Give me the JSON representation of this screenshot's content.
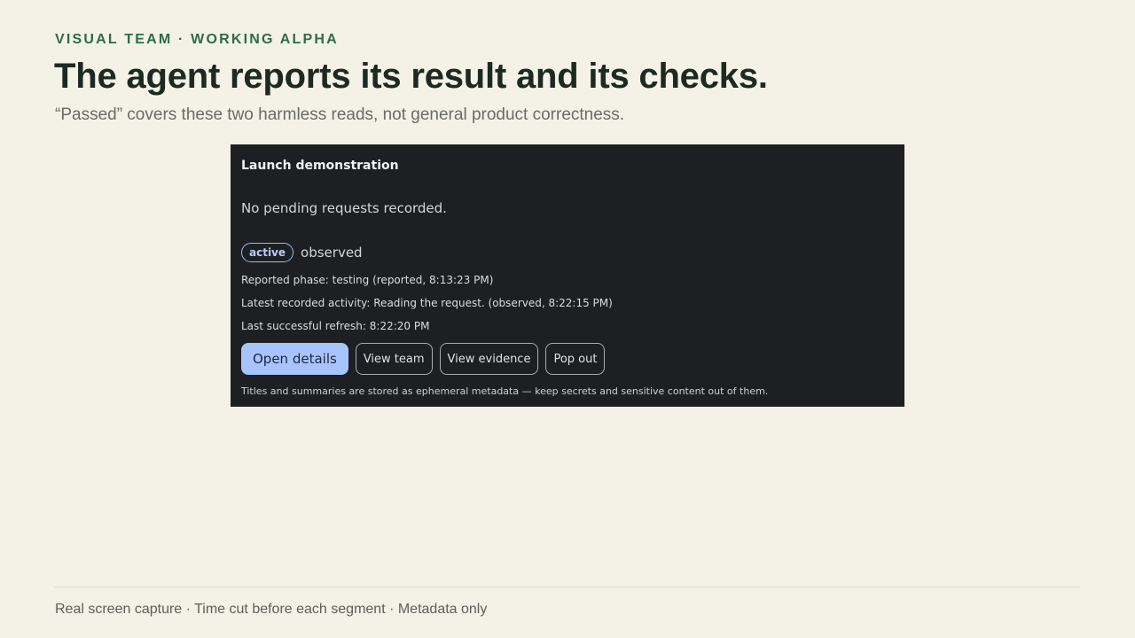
{
  "slide": {
    "eyebrow": "VISUAL TEAM · WORKING ALPHA",
    "title": "The agent reports its result and its checks.",
    "subtitle": "“Passed” covers these two harmless reads, not general product correctness.",
    "footer": "Real screen capture · Time cut before each segment · Metadata only"
  },
  "capture": {
    "heading": "Launch demonstration",
    "empty_message": "No pending requests recorded.",
    "status_badge": "active",
    "status_observed": "observed",
    "reported_phase": "Reported phase: testing (reported, 8:13:23 PM)",
    "latest_activity": "Latest recorded activity: Reading the request. (observed, 8:22:15 PM)",
    "last_refresh": "Last successful refresh: 8:22:20 PM",
    "buttons": {
      "open_details": "Open details",
      "view_team": "View team",
      "view_evidence": "View evidence",
      "pop_out": "Pop out"
    },
    "note": "Titles and summaries are stored as ephemeral metadata — keep secrets and sensitive content out of them."
  },
  "colors": {
    "background": "#f4f1e6",
    "accent_green": "#2e6b4a",
    "panel": "#1d1f22",
    "primary_button": "#a8c4ff"
  }
}
